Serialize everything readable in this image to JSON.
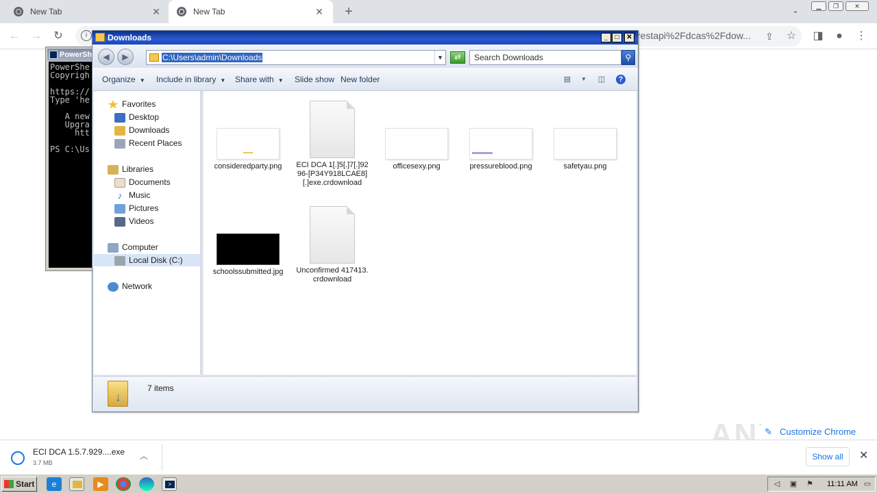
{
  "chrome": {
    "tabs": [
      {
        "title": "New Tab",
        "active": false
      },
      {
        "title": "New Tab",
        "active": true
      }
    ],
    "new_tab_symbol": "+",
    "url_text": "restapi%2Fdcas%2Fdow...",
    "icons": [
      "back-icon",
      "forward-icon",
      "reload-icon",
      "info-icon",
      "share-icon",
      "star-icon",
      "sidepanel-icon",
      "profile-icon",
      "menu-icon"
    ]
  },
  "powershell": {
    "title": "PowerSh",
    "lines": "PowerShe\nCopyrigh\n\nhttps://\nType 'he\n\n   A new\n   Upgra\n     htt\n\nPS C:\\Us"
  },
  "explorer": {
    "title": "Downloads",
    "address": "C:\\Users\\admin\\Downloads",
    "search_placeholder": "Search Downloads",
    "commands": [
      "Organize",
      "Include in library",
      "Share with",
      "Slide show",
      "New folder"
    ],
    "nav": {
      "favorites": "Favorites",
      "desktop": "Desktop",
      "downloads": "Downloads",
      "recent": "Recent Places",
      "libraries": "Libraries",
      "documents": "Documents",
      "music": "Music",
      "pictures": "Pictures",
      "videos": "Videos",
      "computer": "Computer",
      "localdisk": "Local Disk (C:)",
      "network": "Network"
    },
    "files": [
      {
        "name": "consideredparty.png",
        "kind": "image"
      },
      {
        "name": "ECI DCA 1[.]5[.]7[.]9296-[P34Y918LCAE8][.]exe.crdownload",
        "kind": "doc"
      },
      {
        "name": "officesexy.png",
        "kind": "image"
      },
      {
        "name": "pressureblood.png",
        "kind": "image"
      },
      {
        "name": "safetyau.png",
        "kind": "image"
      },
      {
        "name": "schoolssubmitted.jpg",
        "kind": "dark"
      },
      {
        "name": "Unconfirmed 417413.crdownload",
        "kind": "doc"
      }
    ],
    "status": "7 items"
  },
  "download_bar": {
    "file_name": "ECI DCA 1.5.7.929....exe",
    "file_size": "3.7 MB",
    "show_all": "Show all"
  },
  "customize_chrome": "Customize Chrome",
  "watermark": "ANY RUN",
  "taskbar": {
    "start": "Start",
    "clock": "11:11 AM"
  }
}
